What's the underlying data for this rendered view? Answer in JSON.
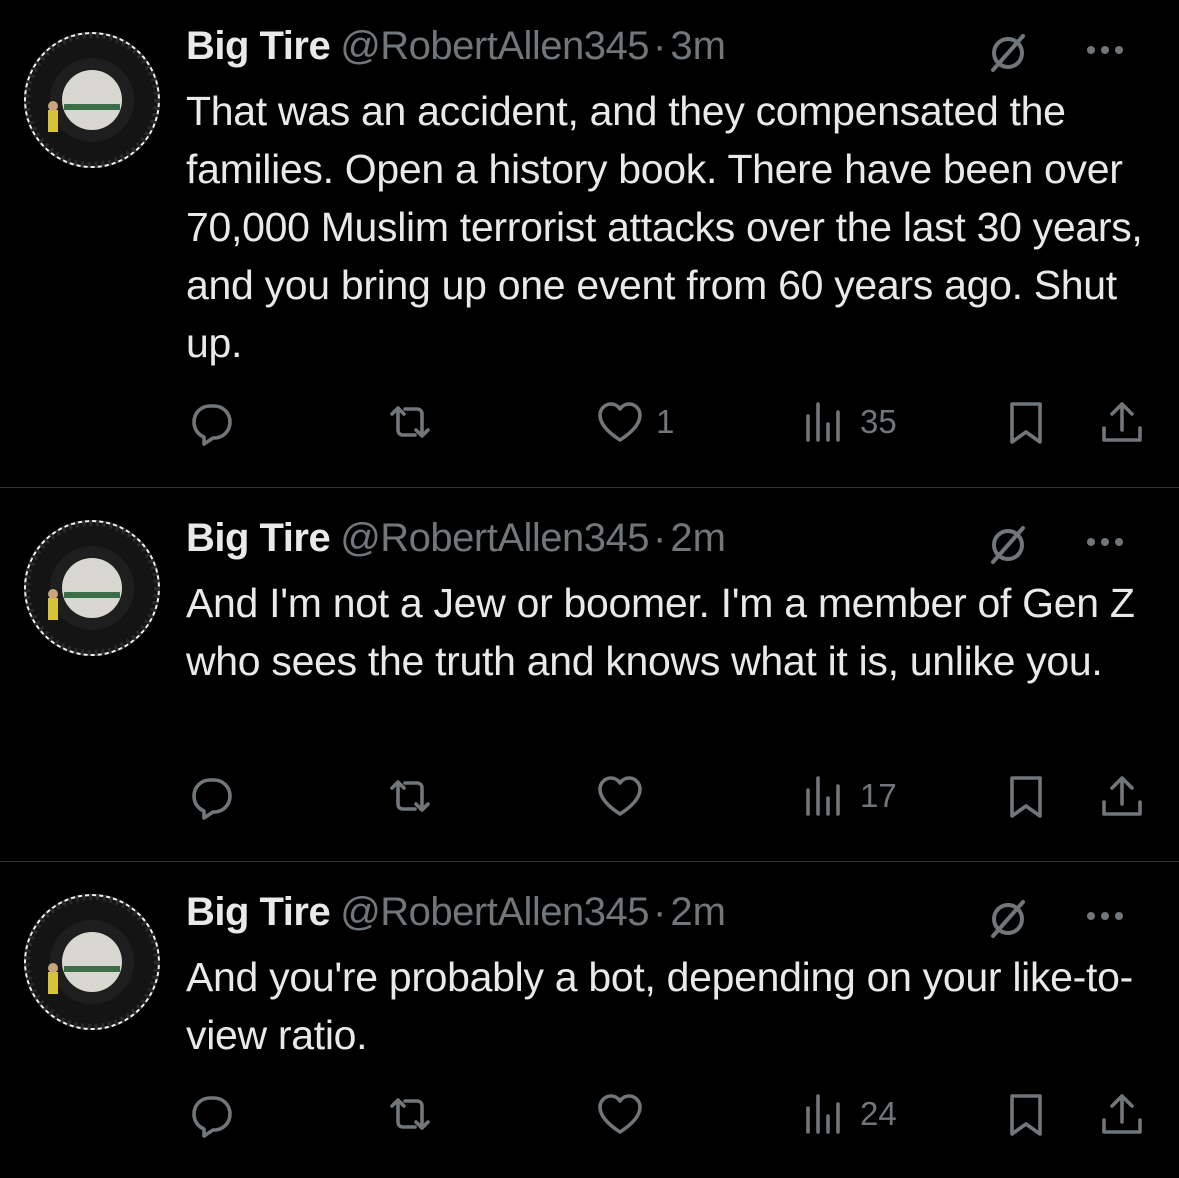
{
  "icons": {
    "reply": "reply-icon",
    "retweet": "retweet-icon",
    "like": "like-icon",
    "views": "views-icon",
    "bookmark": "bookmark-icon",
    "share": "share-icon",
    "mute": "muted-icon",
    "more": "more-icon"
  },
  "colors": {
    "background": "#000000",
    "text": "#e7e9ea",
    "secondary": "#71767b",
    "divider": "#2f3336"
  },
  "tweets": [
    {
      "name": "Big Tire",
      "handle": "@RobertAllen345",
      "separator": "·",
      "time": "3m",
      "text": "That was an accident, and they compensated the families. Open a history book. There have been over 70,000 Muslim terrorist attacks over the last 30 years, and you bring up one event from 60 years ago. Shut up.",
      "likes": "1",
      "views": "35"
    },
    {
      "name": "Big Tire",
      "handle": "@RobertAllen345",
      "separator": "·",
      "time": "2m",
      "text": "And I'm not a Jew or boomer. I'm a member of Gen Z who sees the truth and knows what it is, unlike you.",
      "likes": "",
      "views": "17"
    },
    {
      "name": "Big Tire",
      "handle": "@RobertAllen345",
      "separator": "·",
      "time": "2m",
      "text": "And you're probably a bot, depending on your like-to-view ratio.",
      "likes": "",
      "views": "24"
    }
  ]
}
